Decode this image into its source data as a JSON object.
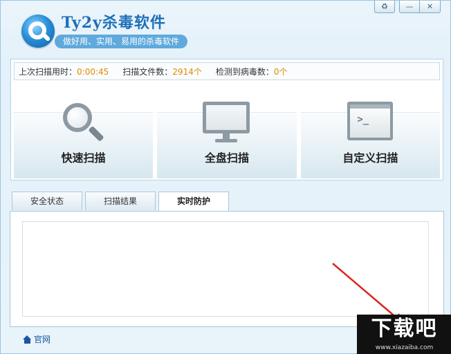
{
  "header": {
    "title": "Ty2y杀毒软件",
    "slogan": "做好用、实用、易用的杀毒软件",
    "controls": {
      "skin": "♻",
      "minimize": "—",
      "close": "✕"
    }
  },
  "stats": {
    "last_scan_label": "上次扫描用时：",
    "last_scan_value": "0:00:45",
    "files_label": "扫描文件数：",
    "files_value": "2914个",
    "virus_label": "检测到病毒数：",
    "virus_value": "0个"
  },
  "scan": {
    "quick": "快速扫描",
    "full": "全盘扫描",
    "custom": "自定义扫描",
    "terminal_prompt": ">_"
  },
  "tabs": [
    {
      "label": "安全状态"
    },
    {
      "label": "扫描结果"
    },
    {
      "label": "实时防护"
    }
  ],
  "footer": {
    "official_site": "官网"
  },
  "watermark": {
    "big": "下载吧",
    "small": "www.xiazaiba.com"
  },
  "colors": {
    "accent": "#1d6fb8",
    "value": "#e08a00",
    "arrow": "#d9261c"
  }
}
